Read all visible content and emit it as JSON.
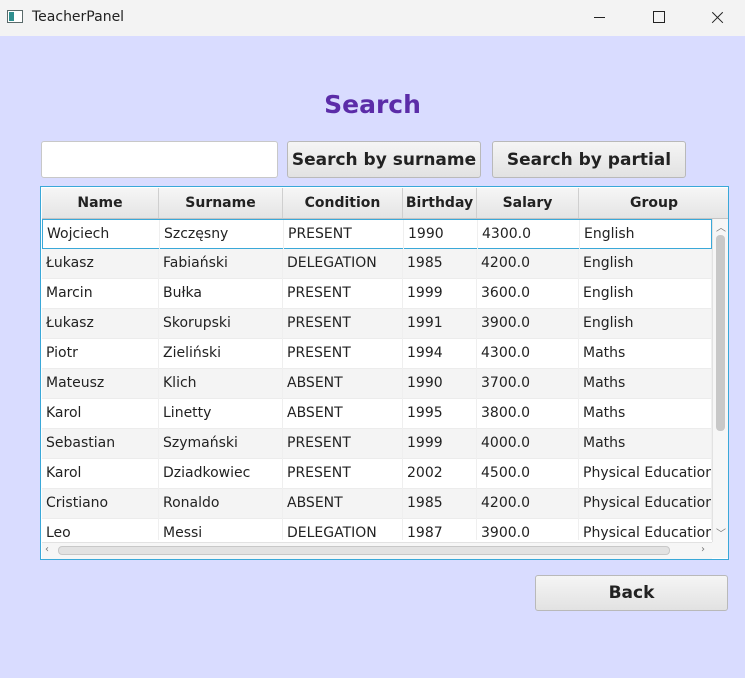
{
  "window": {
    "title": "TeacherPanel"
  },
  "heading": "Search",
  "search": {
    "value": "",
    "placeholder": ""
  },
  "buttons": {
    "surname": "Search by surname",
    "partial": "Search by partial",
    "back": "Back"
  },
  "table": {
    "columns": [
      "Name",
      "Surname",
      "Condition",
      "Birthday",
      "Salary",
      "Group"
    ],
    "rows": [
      [
        "Wojciech",
        "Szczęsny",
        "PRESENT",
        "1990",
        "4300.0",
        "English"
      ],
      [
        "Łukasz",
        "Fabiański",
        "DELEGATION",
        "1985",
        "4200.0",
        "English"
      ],
      [
        "Marcin",
        "Bułka",
        "PRESENT",
        "1999",
        "3600.0",
        "English"
      ],
      [
        "Łukasz",
        "Skorupski",
        "PRESENT",
        "1991",
        "3900.0",
        "English"
      ],
      [
        "Piotr",
        "Zieliński",
        "PRESENT",
        "1994",
        "4300.0",
        "Maths"
      ],
      [
        "Mateusz",
        "Klich",
        "ABSENT",
        "1990",
        "3700.0",
        "Maths"
      ],
      [
        "Karol",
        "Linetty",
        "ABSENT",
        "1995",
        "3800.0",
        "Maths"
      ],
      [
        "Sebastian",
        "Szymański",
        "PRESENT",
        "1999",
        "4000.0",
        "Maths"
      ],
      [
        "Karol",
        "Dziadkowiec",
        "PRESENT",
        "2002",
        "4500.0",
        "Physical Education"
      ],
      [
        "Cristiano",
        "Ronaldo",
        "ABSENT",
        "1985",
        "4200.0",
        "Physical Education"
      ],
      [
        "Leo",
        "Messi",
        "DELEGATION",
        "1987",
        "3900.0",
        "Physical Education"
      ]
    ]
  },
  "icons": {
    "up": "scroll-up-arrow",
    "down": "scroll-down-arrow",
    "left": "scroll-left-arrow",
    "right": "scroll-right-arrow"
  }
}
